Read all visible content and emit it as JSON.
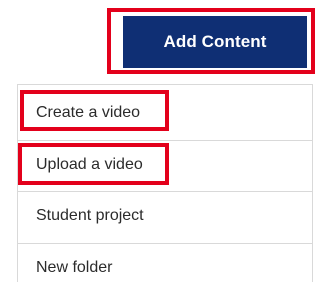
{
  "toolbar": {
    "add_content_label": "Add Content"
  },
  "menu": {
    "items": [
      {
        "label": "Create a video"
      },
      {
        "label": "Upload a video"
      },
      {
        "label": "Student project"
      },
      {
        "label": "New folder"
      }
    ]
  },
  "colors": {
    "button_bg": "#0f2f74",
    "highlight": "#e3001b",
    "divider": "#d9d9d9"
  }
}
